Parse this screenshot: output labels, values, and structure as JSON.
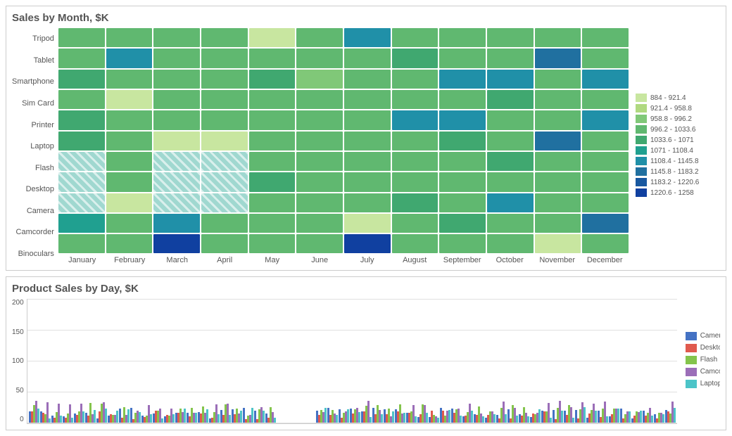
{
  "topChart": {
    "title": "Sales by Month, $K",
    "yLabels": [
      "Tripod",
      "Tablet",
      "Smartphone",
      "Sim Card",
      "Printer",
      "Laptop",
      "Flash",
      "Desktop",
      "Camera",
      "Camcorder",
      "Binoculars"
    ],
    "xLabels": [
      "January",
      "February",
      "March",
      "April",
      "May",
      "June",
      "July",
      "August",
      "September",
      "October",
      "November",
      "December"
    ],
    "legend": [
      {
        "range": "884 - 921.4",
        "color": "#c8e6a0"
      },
      {
        "range": "921.4 - 958.8",
        "color": "#b0d980"
      },
      {
        "range": "958.8 - 996.2",
        "color": "#80c878"
      },
      {
        "range": "996.2 - 1033.6",
        "color": "#60b870"
      },
      {
        "range": "1033.6 - 1071",
        "color": "#40a870"
      },
      {
        "range": "1071 - 1108.4",
        "color": "#20a090"
      },
      {
        "range": "1108.4 - 1145.8",
        "color": "#2090a8"
      },
      {
        "range": "1145.8 - 1183.2",
        "color": "#2070a0"
      },
      {
        "range": "1183.2 - 1220.6",
        "color": "#1858a0"
      },
      {
        "range": "1220.6 - 1258",
        "color": "#1040a0"
      }
    ]
  },
  "bottomChart": {
    "title": "Product Sales by Day, $K",
    "yAxis": [
      "0",
      "50",
      "100",
      "150",
      "200"
    ],
    "legend": [
      {
        "label": "Camera",
        "color": "#4472c4"
      },
      {
        "label": "Desktop",
        "color": "#e05a4e"
      },
      {
        "label": "Flash",
        "color": "#84c44c"
      },
      {
        "label": "Camcorder",
        "color": "#9b6eb8"
      },
      {
        "label": "Laptop",
        "color": "#4cc4c8"
      }
    ]
  }
}
